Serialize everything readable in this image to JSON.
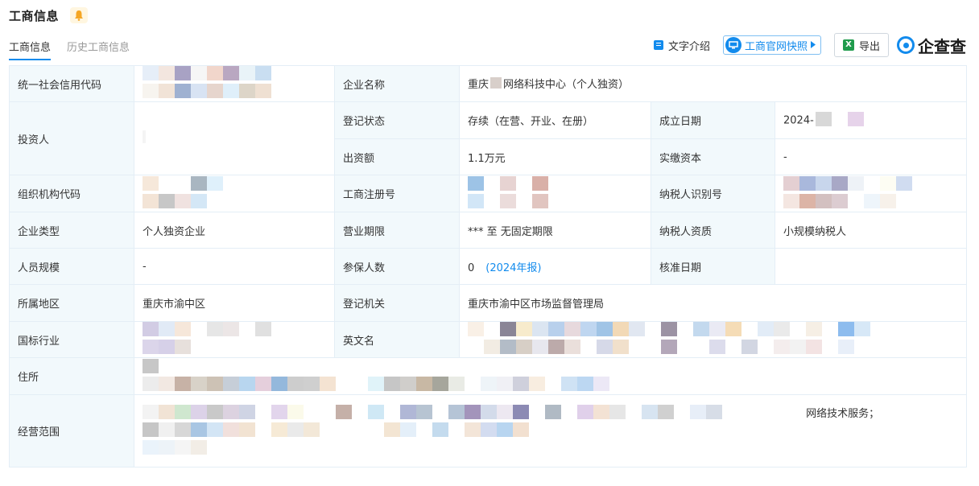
{
  "header": {
    "title": "工商信息"
  },
  "tabs": [
    {
      "label": "工商信息",
      "active": true
    },
    {
      "label": "历史工商信息",
      "active": false
    }
  ],
  "toolbar": {
    "text_intro": "文字介绍",
    "snapshot": "工商官网快照",
    "export": "导出",
    "brand": "企查查"
  },
  "rows": {
    "credit_code": {
      "label": "统一社会信用代码"
    },
    "company_name": {
      "label": "企业名称",
      "value_prefix": "重庆",
      "value_suffix": "网络科技中心（个人独资）"
    },
    "investor": {
      "label": "投资人"
    },
    "reg_status": {
      "label": "登记状态",
      "value": "存续（在营、开业、在册）"
    },
    "found_date": {
      "label": "成立日期",
      "value_prefix": "2024-"
    },
    "capital": {
      "label": "出资额",
      "value": "1.1万元"
    },
    "paid_capital": {
      "label": "实缴资本",
      "value": "-"
    },
    "org_code": {
      "label": "组织机构代码"
    },
    "reg_no": {
      "label": "工商注册号"
    },
    "taxpayer_id": {
      "label": "纳税人识别号"
    },
    "company_type": {
      "label": "企业类型",
      "value": "个人独资企业"
    },
    "term": {
      "label": "营业期限",
      "value": "*** 至 无固定期限"
    },
    "taxpayer_qual": {
      "label": "纳税人资质",
      "value": "小规模纳税人"
    },
    "staff_size": {
      "label": "人员规模",
      "value": "-"
    },
    "insured": {
      "label": "参保人数",
      "value": "0",
      "report_link": "(2024年报)"
    },
    "approve_date": {
      "label": "核准日期",
      "value": ""
    },
    "region": {
      "label": "所属地区",
      "value": "重庆市渝中区"
    },
    "authority": {
      "label": "登记机关",
      "value": "重庆市渝中区市场监督管理局"
    },
    "industry": {
      "label": "国标行业"
    },
    "english_name": {
      "label": "英文名"
    },
    "address": {
      "label": "住所"
    },
    "scope": {
      "label": "经营范围",
      "visible_text": "网络技术服务；"
    }
  },
  "colors": {
    "accent": "#128bed",
    "label_bg": "#f2f9fc",
    "border": "#e4eef6",
    "warning": "#f5a623",
    "excel": "#1f9b4c"
  },
  "icons": [
    "bell-icon",
    "document-icon",
    "monitor-icon",
    "chevron-right-icon",
    "excel-icon",
    "brand-logo-icon"
  ]
}
